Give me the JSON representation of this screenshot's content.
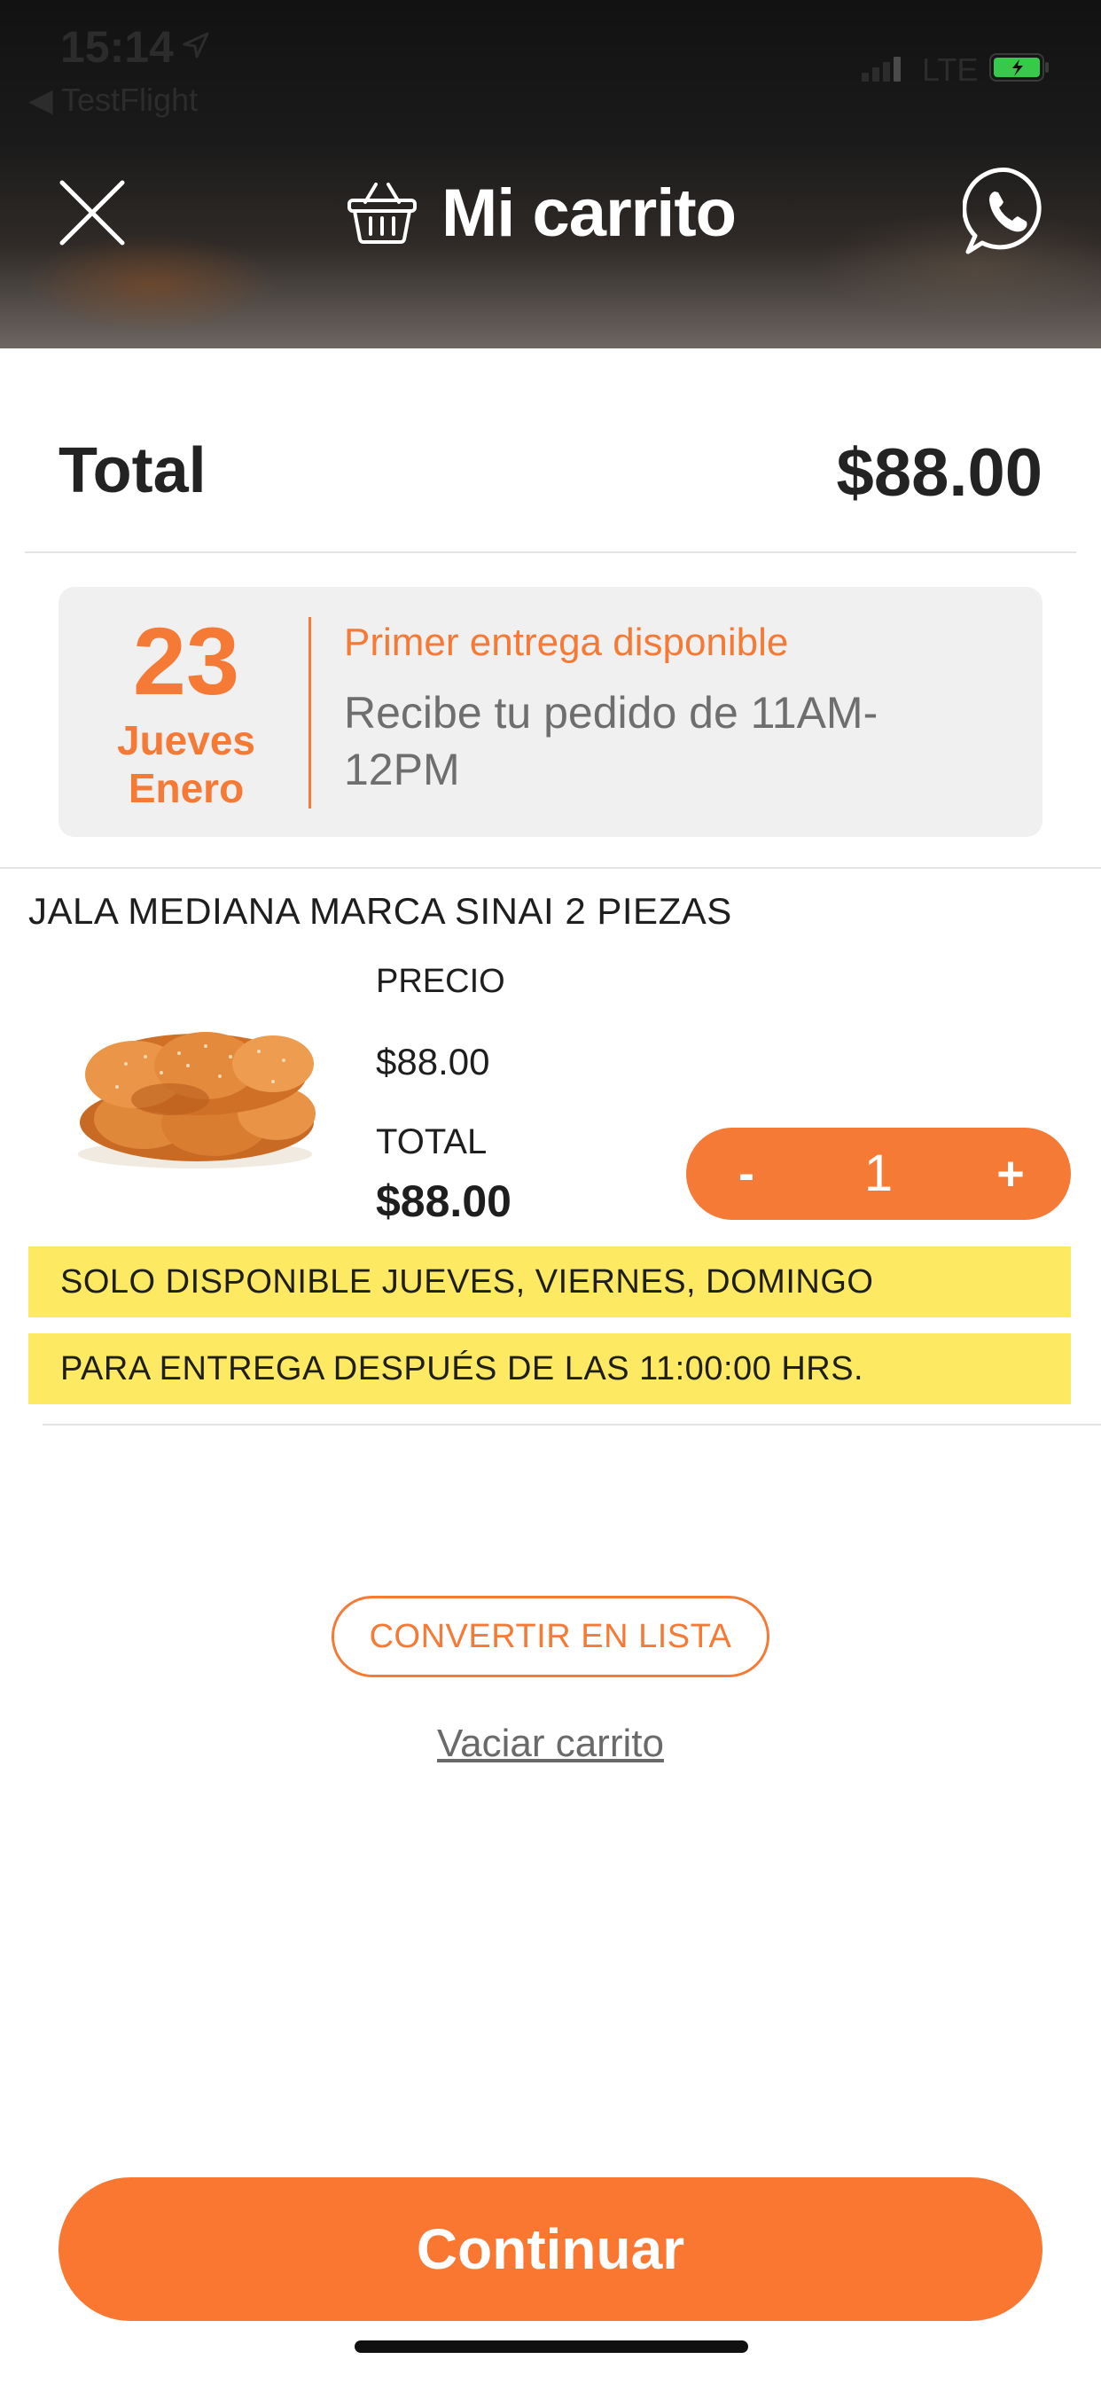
{
  "status_bar": {
    "time": "15:14",
    "back_app": "◀ TestFlight",
    "network": "LTE"
  },
  "header": {
    "title": "Mi carrito",
    "icons": [
      "close-icon",
      "basket-icon",
      "whatsapp-icon"
    ]
  },
  "summary": {
    "total_label": "Total",
    "total_value": "$88.00"
  },
  "delivery": {
    "day": "23",
    "weekday": "Jueves",
    "month": "Enero",
    "heading": "Primer entrega disponible",
    "text": "Recibe tu pedido de 11AM-12PM"
  },
  "product": {
    "name": "JALA MEDIANA MARCA SINAI 2 PIEZAS",
    "price_label": "PRECIO",
    "price_value": "$88.00",
    "total_label": "TOTAL",
    "total_value": "$88.00",
    "quantity": "1",
    "minus_label": "-",
    "plus_label": "+",
    "notices": [
      "SOLO DISPONIBLE JUEVES, VIERNES, DOMINGO",
      "PARA ENTREGA DESPUÉS DE LAS 11:00:00 HRS."
    ]
  },
  "actions": {
    "convert_label": "CONVERTIR EN LISTA",
    "empty_label": "Vaciar carrito",
    "continue_label": "Continuar"
  },
  "colors": {
    "accent": "#f57a35",
    "button": "#f97731",
    "notice_bg": "#fdea62",
    "card_bg": "#f0f0f0"
  }
}
